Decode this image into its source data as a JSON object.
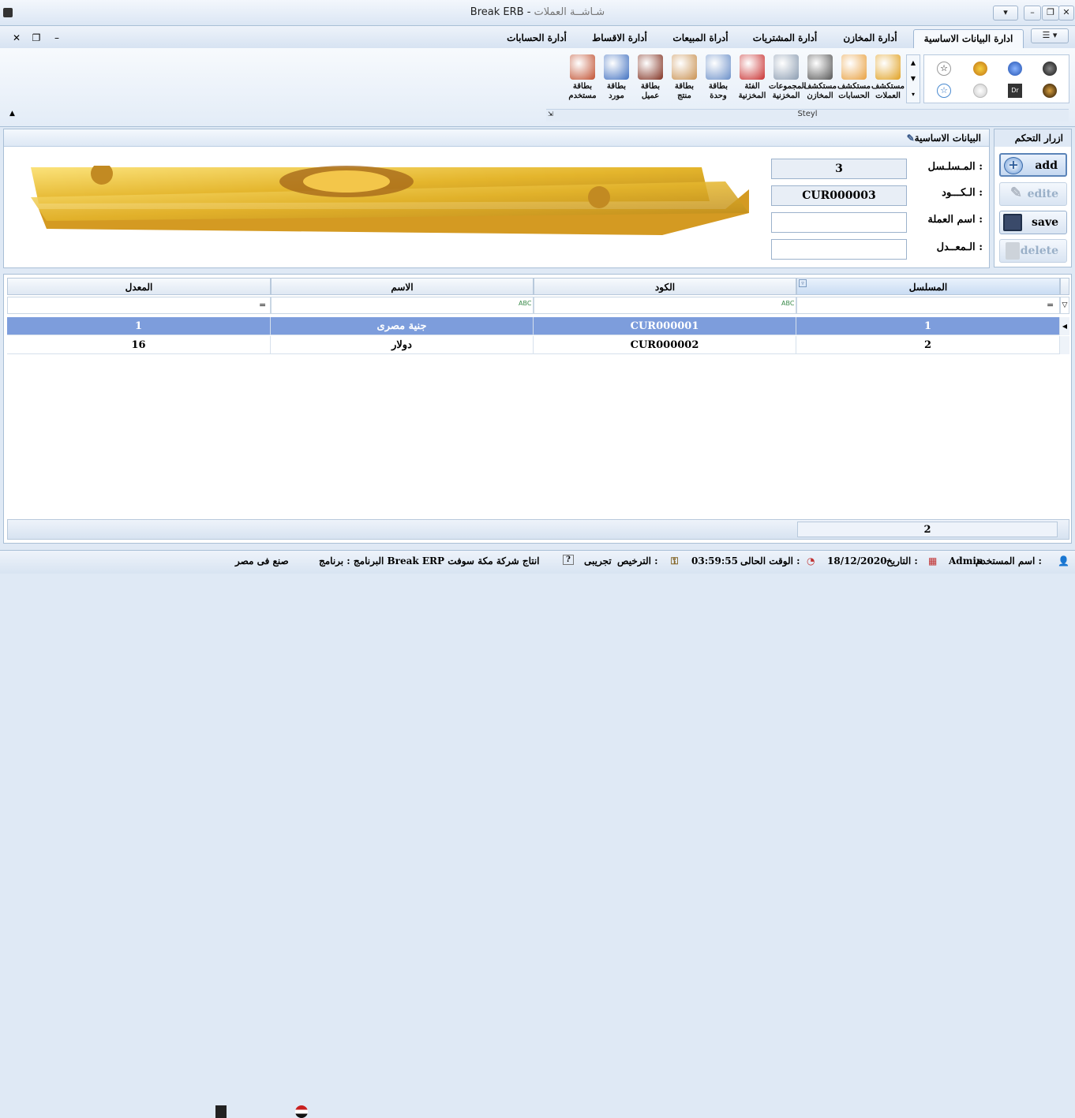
{
  "window": {
    "app_name": "Break ERB",
    "title_sep": " - ",
    "screen_name": "شـاشــة العملات"
  },
  "tabs": [
    {
      "label": "ادارة البيانات الاساسية",
      "active": true
    },
    {
      "label": "أدارة المخازن"
    },
    {
      "label": "أدارة المشتريات"
    },
    {
      "label": "أدراة المبيعات"
    },
    {
      "label": "أدارة الاقساط"
    },
    {
      "label": "أدارة الحسابات"
    }
  ],
  "ribbon": {
    "group_label": "Steyl",
    "buttons": [
      {
        "line1": "مستكشف",
        "line2": "العملات",
        "icon": "currency-icon",
        "color": "#e0a020"
      },
      {
        "line1": "مستكشف",
        "line2": "الحسابات",
        "icon": "accounts-tree-icon",
        "color": "#e8a040"
      },
      {
        "line1": "مستكشف",
        "line2": "المخازن",
        "icon": "warehouse-icon",
        "color": "#555555"
      },
      {
        "line1": "المجموعات",
        "line2": "المخزنية",
        "icon": "groups-icon",
        "color": "#8a9bb0"
      },
      {
        "line1": "الفئة",
        "line2": "المخزنية",
        "icon": "category-icon",
        "color": "#c83030"
      },
      {
        "line1": "بطاقة",
        "line2": "وحدة",
        "icon": "unit-card-icon",
        "color": "#6a8fc8"
      },
      {
        "line1": "بطاقة",
        "line2": "منتج",
        "icon": "product-card-icon",
        "color": "#c89050"
      },
      {
        "line1": "بطاقة",
        "line2": "عميل",
        "icon": "customer-card-icon",
        "color": "#803020"
      },
      {
        "line1": "بطاقة",
        "line2": "مورد",
        "icon": "supplier-card-icon",
        "color": "#4070c0"
      },
      {
        "line1": "بطاقة",
        "line2": "مستخدم",
        "icon": "user-card-icon",
        "color": "#c05030"
      }
    ]
  },
  "controls_panel": {
    "title": "ازرار التحكم",
    "buttons": [
      {
        "label": "add",
        "state": "active",
        "icon": "add-icon"
      },
      {
        "label": "edite",
        "state": "disabled",
        "icon": "edit-icon"
      },
      {
        "label": "save",
        "state": "normal",
        "icon": "save-icon"
      },
      {
        "label": "delete",
        "state": "disabled",
        "icon": "delete-icon"
      }
    ]
  },
  "form": {
    "title": "البيانات الاساسية",
    "fields": [
      {
        "label": "المـسلـسل :",
        "value": "3"
      },
      {
        "label": "الـكـــود :",
        "value": "CUR000003"
      },
      {
        "label": "اسم العملة :",
        "value": ""
      },
      {
        "label": "الـمعــدل :",
        "value": ""
      }
    ]
  },
  "grid": {
    "columns": [
      "المسلسل",
      "الكود",
      "الاسم",
      "المعدل"
    ],
    "rows": [
      {
        "serial": "1",
        "code": "CUR000001",
        "name": "جنية مصرى",
        "rate": "1",
        "selected": true
      },
      {
        "serial": "2",
        "code": "CUR000002",
        "name": "دولار",
        "rate": "16"
      }
    ],
    "footer_count": "2"
  },
  "status": {
    "user_label": "اسم المستخدم :",
    "user": "Admin",
    "date_label": "التاريخ :",
    "date": "18/12/2020",
    "time_label": "الوقت الحالى :",
    "time": "03:59:55",
    "license_label": "الترخيص :",
    "license": "تجريبى",
    "program": "البرنامج : برنامج Break ERP  انتاج شركة مكة سوفت",
    "made": "صنع فى مصر"
  }
}
